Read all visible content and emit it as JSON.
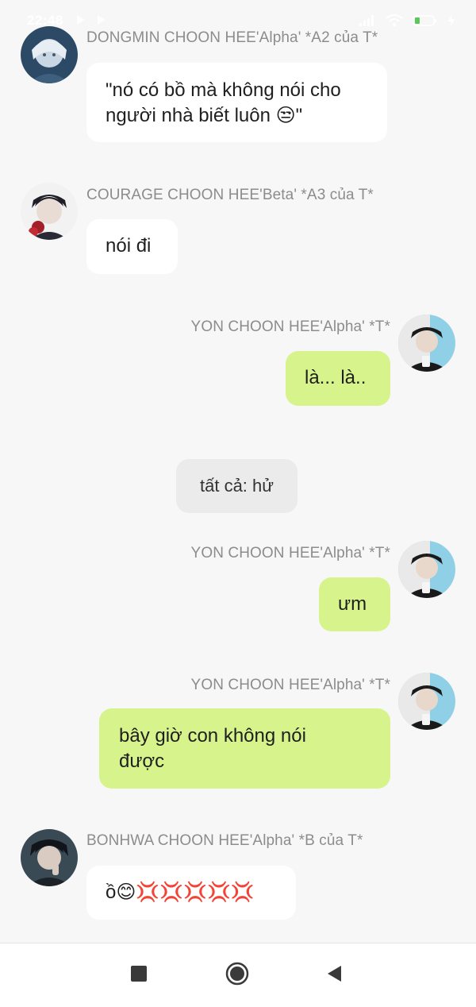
{
  "status_bar": {
    "time": "22:48"
  },
  "messages": [
    {
      "sender": "DONGMIN CHOON HEE'Alpha' *A2 của T*",
      "text": "\"nó có bồ mà không nói cho người nhà biết luôn 😒\"",
      "line1": "\"nó có bồ mà không nói cho",
      "line2": "người nhà biết luôn 😒\""
    },
    {
      "sender": "COURAGE CHOON HEE'Beta' *A3 của T*",
      "text": "nói đi"
    },
    {
      "sender": "YON CHOON HEE'Alpha' *T*",
      "text": "là... là.."
    },
    {
      "system": "tất cả: hử"
    },
    {
      "sender": "YON CHOON HEE'Alpha' *T*",
      "text": "ưm"
    },
    {
      "sender": "YON CHOON HEE'Alpha' *T*",
      "line1": "bây giờ con không nói",
      "line2": "được"
    },
    {
      "sender": "BONHWA CHOON HEE'Alpha' *B của T*",
      "text": "ồ😊💢💢💢💢💢"
    }
  ],
  "nav": {
    "recent": "square-icon",
    "home": "circle-icon",
    "back": "triangle-back-icon"
  },
  "colors": {
    "background": "#f7f7f7",
    "bubble_left": "#ffffff",
    "bubble_right": "#d7f48c",
    "system_bubble": "#ebebeb",
    "sender_text": "#8c8c8c"
  }
}
